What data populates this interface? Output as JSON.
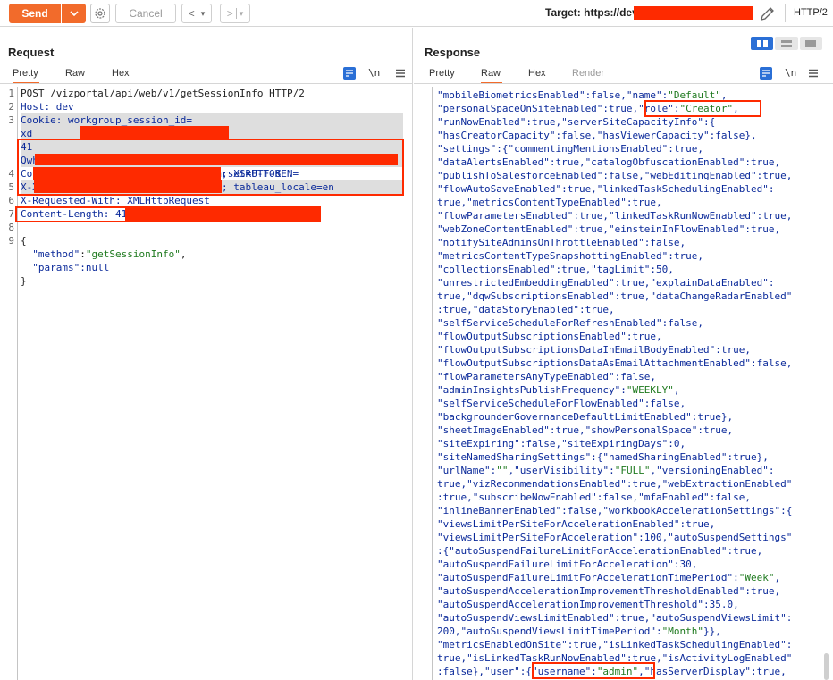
{
  "toolbar": {
    "send_label": "Send",
    "cancel_label": "Cancel",
    "back_label": "<",
    "forward_label": ">",
    "dropdown_glyph": "▾",
    "target_label": "Target: https://dev",
    "protocol_label": "HTTP/2",
    "accent": "#f26b2b"
  },
  "request": {
    "title": "Request",
    "tabs": [
      "Pretty",
      "Raw",
      "Hex"
    ],
    "active_tab": "Pretty",
    "newline_toggle": "\\n",
    "lines": [
      {
        "n": "1",
        "text": "POST /vizportal/api/web/v1/getSessionInfo HTTP/2"
      },
      {
        "n": "2",
        "text": "Host: dev"
      },
      {
        "n": "3",
        "text": "Cookie: workgroup_session_id="
      },
      {
        "n": "",
        "text": "xd"
      },
      {
        "n": "",
        "text": "41"
      },
      {
        "n": "",
        "text": "Qwh"
      },
      {
        "n": "4",
        "text": "Content-Type: application/json;charset=UTF-8"
      },
      {
        "n": "5",
        "text": "X-Xsrf-Token: Qwh"
      },
      {
        "n": "6",
        "text": "X-Requested-With: XMLHttpRequest"
      },
      {
        "n": "7",
        "text": "Content-Length: 41"
      },
      {
        "n": "8",
        "text": ""
      },
      {
        "n": "9",
        "text": "{"
      },
      {
        "n": "",
        "text": "  \"method\":\"getSessionInfo\","
      },
      {
        "n": "",
        "text": "  \"params\":null"
      },
      {
        "n": "",
        "text": "}"
      }
    ],
    "xsrf_fragment": "; XSRF-TOKEN=",
    "locale_fragment": "; tableau_locale=en",
    "method_key": "\"method\"",
    "method_value": "\"getSessionInfo\"",
    "params_key": "\"params\"",
    "params_value": ":null"
  },
  "response": {
    "title": "Response",
    "tabs": [
      "Pretty",
      "Raw",
      "Hex",
      "Render"
    ],
    "active_tab": "Raw",
    "newline_toggle": "\\n",
    "lines": [
      "\"mobileBiometricsEnabled\":false,\"name\":\"Default\",",
      "\"personalSpaceOnSiteEnabled\":true,\"role\":\"Creator\",",
      "\"runNowEnabled\":true,\"serverSiteCapacityInfo\":{",
      "\"hasCreatorCapacity\":false,\"hasViewerCapacity\":false},",
      "\"settings\":{\"commentingMentionsEnabled\":true,",
      "\"dataAlertsEnabled\":true,\"catalogObfuscationEnabled\":true,",
      "\"publishToSalesforceEnabled\":false,\"webEditingEnabled\":true,",
      "\"flowAutoSaveEnabled\":true,\"linkedTaskSchedulingEnabled\":",
      "true,\"metricsContentTypeEnabled\":true,",
      "\"flowParametersEnabled\":true,\"linkedTaskRunNowEnabled\":true,",
      "\"webZoneContentEnabled\":true,\"einsteinInFlowEnabled\":true,",
      "\"notifySiteAdminsOnThrottleEnabled\":false,",
      "\"metricsContentTypeSnapshottingEnabled\":true,",
      "\"collectionsEnabled\":true,\"tagLimit\":50,",
      "\"unrestrictedEmbeddingEnabled\":true,\"explainDataEnabled\":",
      "true,\"dqwSubscriptionsEnabled\":true,\"dataChangeRadarEnabled\"",
      ":true,\"dataStoryEnabled\":true,",
      "\"selfServiceScheduleForRefreshEnabled\":false,",
      "\"flowOutputSubscriptionsEnabled\":true,",
      "\"flowOutputSubscriptionsDataInEmailBodyEnabled\":true,",
      "\"flowOutputSubscriptionsDataAsEmailAttachmentEnabled\":false,",
      "\"flowParametersAnyTypeEnabled\":false,",
      "\"adminInsightsPublishFrequency\":\"WEEKLY\",",
      "\"selfServiceScheduleForFlowEnabled\":false,",
      "\"backgrounderGovernanceDefaultLimitEnabled\":true},",
      "\"sheetImageEnabled\":true,\"showPersonalSpace\":true,",
      "\"siteExpiring\":false,\"siteExpiringDays\":0,",
      "\"siteNamedSharingSettings\":{\"namedSharingEnabled\":true},",
      "\"urlName\":\"\",\"userVisibility\":\"FULL\",\"versioningEnabled\":",
      "true,\"vizRecommendationsEnabled\":true,\"webExtractionEnabled\"",
      ":true,\"subscribeNowEnabled\":false,\"mfaEnabled\":false,",
      "\"inlineBannerEnabled\":false,\"workbookAccelerationSettings\":{",
      "\"viewsLimitPerSiteForAccelerationEnabled\":true,",
      "\"viewsLimitPerSiteForAcceleration\":100,\"autoSuspendSettings\"",
      ":{\"autoSuspendFailureLimitForAccelerationEnabled\":true,",
      "\"autoSuspendFailureLimitForAcceleration\":30,",
      "\"autoSuspendFailureLimitForAccelerationTimePeriod\":\"Week\",",
      "\"autoSuspendAccelerationImprovementThresholdEnabled\":true,",
      "\"autoSuspendAccelerationImprovementThreshold\":35.0,",
      "\"autoSuspendViewsLimitEnabled\":true,\"autoSuspendViewsLimit\":",
      "200,\"autoSuspendViewsLimitTimePeriod\":\"Month\"}},",
      "\"metricsEnabledOnSite\":true,\"isLinkedTaskSchedulingEnabled\":",
      "true,\"isLinkedTaskRunNowEnabled\":true,\"isActivityLogEnabled\"",
      ":false},\"user\":{\"username\":\"admin\",\"hasServerDisplay\":true,"
    ]
  },
  "icons": {
    "send_dropdown": "chevron-down-icon",
    "settings": "gear-icon",
    "edit": "pencil-icon",
    "pretty_wrap": "wrap-icon",
    "menu": "hamburger-icon",
    "layout": "layout-toggle-icon"
  }
}
